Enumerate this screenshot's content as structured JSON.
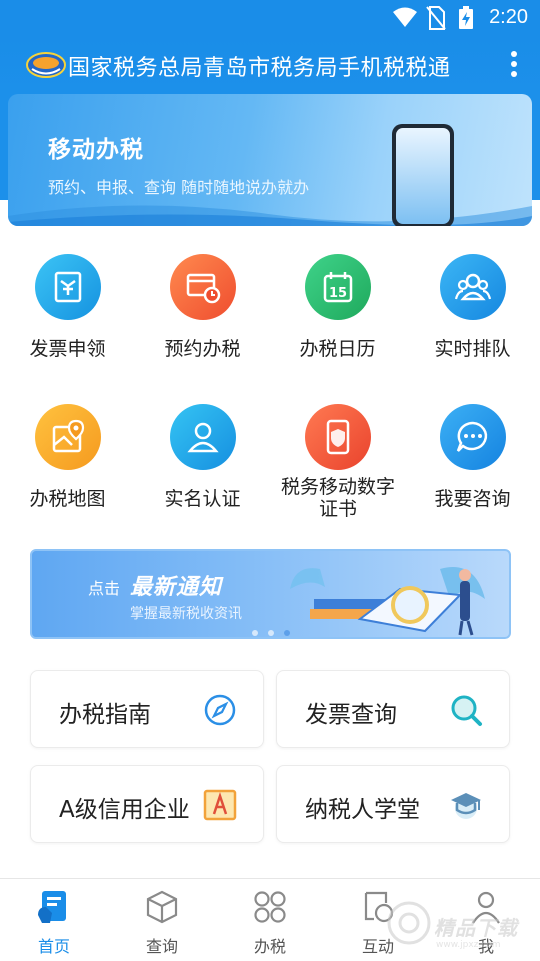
{
  "status_bar": {
    "time": "2:20",
    "icons": [
      "wifi-icon",
      "no-sim-icon",
      "battery-charging-icon"
    ]
  },
  "app_bar": {
    "title": "国家税务总局青岛市税务局手机税税通",
    "logo": "tax-app-logo",
    "menu_icon": "more-vertical-icon"
  },
  "hero_banner": {
    "title": "移动办税",
    "subtitle": "预约、申报、查询 随时随地说办就办"
  },
  "services": [
    {
      "label": "发票申领",
      "icon": "invoice-apply-icon",
      "color": "#1da8e6"
    },
    {
      "label": "预约办税",
      "icon": "appointment-icon",
      "color": "#f56a3e"
    },
    {
      "label": "办税日历",
      "icon": "calendar-icon",
      "color": "#27b36a"
    },
    {
      "label": "实时排队",
      "icon": "queue-people-icon",
      "color": "#1d9ae8"
    },
    {
      "label": "办税地图",
      "icon": "map-icon",
      "color": "#f8a62a"
    },
    {
      "label": "实名认证",
      "icon": "user-verify-icon",
      "color": "#1aa2e6"
    },
    {
      "label": "税务移动数字证书",
      "icon": "digital-cert-icon",
      "color": "#f2573a"
    },
    {
      "label": "我要咨询",
      "icon": "chat-icon",
      "color": "#1d9ae8"
    }
  ],
  "notice_banner": {
    "click": "点击",
    "title": "最新通知",
    "subtitle": "掌握最新税收资讯",
    "page_dots": 3,
    "active_dot": 3
  },
  "quick_links": [
    {
      "label": "办税指南",
      "icon": "compass-icon"
    },
    {
      "label": "发票查询",
      "icon": "search-icon"
    },
    {
      "label": "A级信用企业",
      "icon": "grade-a-icon"
    },
    {
      "label": "纳税人学堂",
      "icon": "graduation-cap-icon"
    }
  ],
  "tab_bar": [
    {
      "label": "首页",
      "icon": "home-icon",
      "active": true
    },
    {
      "label": "查询",
      "icon": "cube-icon",
      "active": false
    },
    {
      "label": "办税",
      "icon": "grid-apps-icon",
      "active": false
    },
    {
      "label": "互动",
      "icon": "interact-icon",
      "active": false
    },
    {
      "label": "我",
      "icon": "person-icon",
      "active": false
    }
  ],
  "watermark": {
    "text": "精品下载",
    "url": "www.jpxz.com"
  },
  "colors": {
    "primary": "#1a8de8",
    "tab_active": "#1a8de8"
  }
}
